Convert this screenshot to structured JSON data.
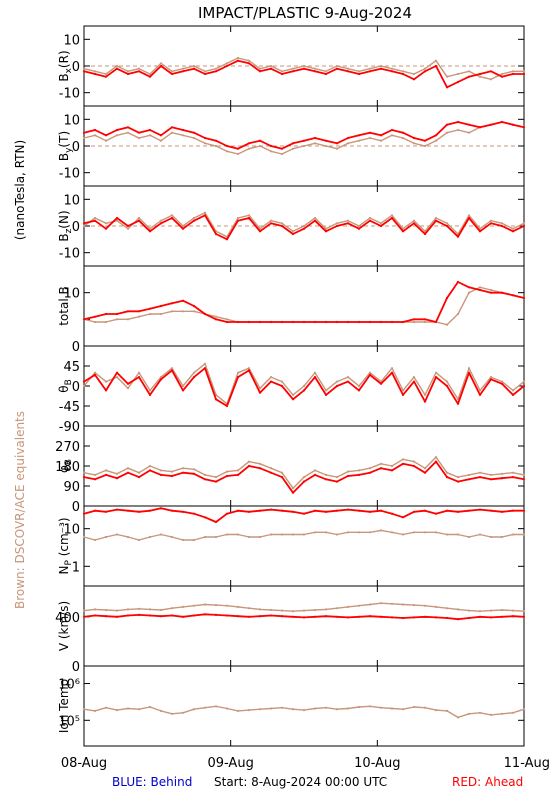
{
  "title": "IMPACT/PLASTIC    9-Aug-2024",
  "side_label": "(nanoTesla, RTN)",
  "brown_label": "Brown: DSCOVR/ACE equivalents",
  "footer": {
    "blue": "BLUE: Behind",
    "start": "Start:  8-Aug-2024 00:00 UTC",
    "red": "RED: Ahead"
  },
  "colors": {
    "ahead": "#ff0000",
    "dscovr": "#c8967a",
    "behind": "#0000cc",
    "brown_label": "#c8967a"
  },
  "chart_data": {
    "type": "line",
    "x_tick_labels": [
      "08-Aug",
      "09-Aug",
      "10-Aug",
      "11-Aug"
    ],
    "x_range_days": [
      0,
      3
    ],
    "panels": [
      {
        "id": "bx",
        "ylabel": "B",
        "ylabel_sub": "x",
        "ylabel_suffix": "(R)",
        "ylim": [
          -15,
          15
        ],
        "scale": "linear",
        "ticks": [
          {
            "v": 10,
            "label": "10"
          },
          {
            "v": 0,
            "label": "0"
          },
          {
            "v": -10,
            "label": "-10"
          }
        ],
        "dashed_zero": true,
        "series": [
          {
            "name": "Ahead",
            "color": "ahead",
            "values": [
              -2,
              -3,
              -4,
              -1,
              -3,
              -2,
              -4,
              0,
              -3,
              -2,
              -1,
              -3,
              -2,
              0,
              2,
              1,
              -2,
              -1,
              -3,
              -2,
              -1,
              -2,
              -3,
              -1,
              -2,
              -3,
              -2,
              -1,
              -2,
              -3,
              -5,
              -2,
              0,
              -8,
              -6,
              -4,
              -3,
              -2,
              -4,
              -3,
              -3
            ]
          },
          {
            "name": "DSCOVR",
            "color": "dscovr",
            "values": [
              -1,
              -2,
              -3,
              0,
              -2,
              -1,
              -3,
              1,
              -2,
              -1,
              0,
              -2,
              -1,
              1,
              3,
              2,
              -1,
              0,
              -2,
              -1,
              0,
              -1,
              -2,
              0,
              -1,
              -2,
              -1,
              0,
              -1,
              -2,
              -3,
              -1,
              2,
              -4,
              -3,
              -2,
              -4,
              -5,
              -3,
              -2,
              -2
            ]
          }
        ]
      },
      {
        "id": "by",
        "ylabel": "B",
        "ylabel_sub": "y",
        "ylabel_suffix": "(T)",
        "ylim": [
          -15,
          15
        ],
        "scale": "linear",
        "ticks": [
          {
            "v": 10,
            "label": "10"
          },
          {
            "v": 0,
            "label": "0"
          },
          {
            "v": -10,
            "label": "-10"
          }
        ],
        "dashed_zero": true,
        "series": [
          {
            "name": "Ahead",
            "color": "ahead",
            "values": [
              5,
              6,
              4,
              6,
              7,
              5,
              6,
              4,
              7,
              6,
              5,
              3,
              2,
              0,
              -1,
              1,
              2,
              0,
              -1,
              1,
              2,
              3,
              2,
              1,
              3,
              4,
              5,
              4,
              6,
              5,
              3,
              2,
              4,
              8,
              9,
              8,
              7,
              8,
              9,
              8,
              7
            ]
          },
          {
            "name": "DSCOVR",
            "color": "dscovr",
            "values": [
              3,
              4,
              2,
              4,
              5,
              3,
              4,
              2,
              5,
              4,
              3,
              1,
              0,
              -2,
              -3,
              -1,
              0,
              -2,
              -3,
              -1,
              0,
              1,
              0,
              -1,
              1,
              2,
              3,
              2,
              4,
              3,
              1,
              0,
              2,
              5,
              6,
              5,
              7,
              8,
              9,
              8,
              7
            ]
          }
        ]
      },
      {
        "id": "bz",
        "ylabel": "B",
        "ylabel_sub": "z",
        "ylabel_suffix": "(N)",
        "ylim": [
          -15,
          15
        ],
        "scale": "linear",
        "ticks": [
          {
            "v": 10,
            "label": "10"
          },
          {
            "v": 0,
            "label": "0"
          },
          {
            "v": -10,
            "label": "-10"
          }
        ],
        "dashed_zero": true,
        "series": [
          {
            "name": "Ahead",
            "color": "ahead",
            "values": [
              1,
              2,
              -1,
              3,
              0,
              2,
              -2,
              1,
              3,
              -1,
              2,
              4,
              -3,
              -5,
              2,
              3,
              -2,
              1,
              0,
              -3,
              -1,
              2,
              -2,
              0,
              1,
              -1,
              2,
              0,
              3,
              -2,
              1,
              -3,
              2,
              0,
              -4,
              3,
              -2,
              1,
              0,
              -2,
              0
            ]
          },
          {
            "name": "DSCOVR",
            "color": "dscovr",
            "values": [
              0,
              3,
              1,
              2,
              -1,
              3,
              -1,
              2,
              4,
              0,
              3,
              5,
              -2,
              -4,
              3,
              4,
              -1,
              2,
              1,
              -2,
              0,
              3,
              -1,
              1,
              2,
              0,
              3,
              1,
              4,
              -1,
              2,
              -2,
              3,
              1,
              -3,
              4,
              -1,
              2,
              1,
              -1,
              1
            ]
          }
        ]
      },
      {
        "id": "btot",
        "ylabel": "total B",
        "ylabel_sub": "",
        "ylabel_suffix": "",
        "ylim": [
          0,
          15
        ],
        "scale": "linear",
        "ticks": [
          {
            "v": 10,
            "label": "10"
          },
          {
            "v": 5,
            "label": ""
          },
          {
            "v": 0,
            "label": "0"
          }
        ],
        "dashed_zero": false,
        "series": [
          {
            "name": "Ahead",
            "color": "ahead",
            "values": [
              5,
              5.5,
              6,
              6,
              6.5,
              6.5,
              7,
              7.5,
              8,
              8.5,
              7.5,
              6,
              5,
              4.5,
              4.5,
              4.5,
              4.5,
              4.5,
              4.5,
              4.5,
              4.5,
              4.5,
              4.5,
              4.5,
              4.5,
              4.5,
              4.5,
              4.5,
              4.5,
              4.5,
              5,
              5,
              4.5,
              9,
              12,
              11,
              10.5,
              10,
              10,
              9.5,
              9
            ]
          },
          {
            "name": "DSCOVR",
            "color": "dscovr",
            "values": [
              5,
              4.5,
              4.5,
              5,
              5,
              5.5,
              6,
              6,
              6.5,
              6.5,
              6.5,
              6,
              5.5,
              5,
              4.5,
              4.5,
              4.5,
              4.5,
              4.5,
              4.5,
              4.5,
              4.5,
              4.5,
              4.5,
              4.5,
              4.5,
              4.5,
              4.5,
              4.5,
              4.5,
              4.5,
              4.5,
              4.5,
              4,
              6,
              10,
              11,
              10.5,
              10,
              9.5,
              9
            ]
          }
        ]
      },
      {
        "id": "theta",
        "ylabel": "θ",
        "ylabel_sub": "B",
        "ylabel_suffix": "",
        "ylim": [
          -90,
          90
        ],
        "scale": "linear",
        "ticks": [
          {
            "v": 45,
            "label": "45"
          },
          {
            "v": 0,
            "label": "0"
          },
          {
            "v": -45,
            "label": "-45"
          },
          {
            "v": -90,
            "label": "-90"
          }
        ],
        "dashed_zero": false,
        "series": [
          {
            "name": "Ahead",
            "color": "ahead",
            "values": [
              10,
              25,
              -10,
              30,
              5,
              20,
              -20,
              15,
              35,
              -10,
              20,
              40,
              -30,
              -45,
              20,
              35,
              -15,
              10,
              0,
              -30,
              -10,
              20,
              -20,
              0,
              10,
              -10,
              25,
              5,
              30,
              -20,
              10,
              -35,
              20,
              0,
              -40,
              30,
              -20,
              15,
              5,
              -20,
              0
            ]
          },
          {
            "name": "DSCOVR",
            "color": "dscovr",
            "values": [
              0,
              30,
              10,
              20,
              -5,
              30,
              -10,
              20,
              40,
              0,
              30,
              50,
              -20,
              -40,
              30,
              40,
              -5,
              20,
              10,
              -20,
              0,
              30,
              -10,
              10,
              20,
              0,
              30,
              10,
              40,
              -10,
              20,
              -20,
              30,
              10,
              -30,
              40,
              -10,
              20,
              10,
              -10,
              10
            ]
          }
        ]
      },
      {
        "id": "phi",
        "ylabel": "φ",
        "ylabel_sub": "B",
        "ylabel_suffix": "",
        "ylim": [
          0,
          360
        ],
        "scale": "linear",
        "ticks": [
          {
            "v": 270,
            "label": "270"
          },
          {
            "v": 180,
            "label": "180"
          },
          {
            "v": 90,
            "label": "90"
          },
          {
            "v": 0,
            "label": "0"
          }
        ],
        "dashed_zero": false,
        "series": [
          {
            "name": "Ahead",
            "color": "ahead",
            "values": [
              130,
              120,
              140,
              125,
              150,
              130,
              160,
              140,
              135,
              150,
              145,
              120,
              110,
              135,
              140,
              180,
              170,
              150,
              130,
              60,
              110,
              140,
              120,
              110,
              135,
              140,
              150,
              170,
              160,
              190,
              180,
              150,
              200,
              130,
              110,
              120,
              130,
              120,
              125,
              130,
              120
            ]
          },
          {
            "name": "DSCOVR",
            "color": "dscovr",
            "values": [
              150,
              140,
              160,
              145,
              170,
              150,
              180,
              160,
              155,
              170,
              165,
              140,
              130,
              155,
              160,
              200,
              190,
              170,
              150,
              80,
              130,
              160,
              140,
              130,
              155,
              160,
              170,
              190,
              180,
              210,
              200,
              170,
              220,
              150,
              130,
              140,
              150,
              140,
              145,
              150,
              140
            ]
          }
        ]
      },
      {
        "id": "np",
        "ylabel": "N",
        "ylabel_sub": "P",
        "ylabel_suffix": " (cm⁻³)",
        "ylim": [
          0.3,
          40
        ],
        "scale": "log",
        "ticks": [
          {
            "v": 10,
            "label": "10"
          },
          {
            "v": 1,
            "label": "1"
          }
        ],
        "dashed_zero": false,
        "series": [
          {
            "name": "Ahead",
            "color": "ahead",
            "values": [
              25,
              30,
              28,
              32,
              30,
              28,
              30,
              35,
              30,
              28,
              25,
              20,
              15,
              25,
              30,
              28,
              30,
              32,
              30,
              28,
              25,
              30,
              28,
              30,
              32,
              30,
              28,
              30,
              25,
              20,
              28,
              30,
              25,
              30,
              28,
              30,
              32,
              30,
              28,
              30,
              30
            ]
          },
          {
            "name": "DSCOVR",
            "color": "dscovr",
            "values": [
              6,
              5,
              6,
              7,
              6,
              5,
              6,
              7,
              6,
              5,
              5,
              6,
              6,
              7,
              7,
              6,
              6,
              7,
              7,
              7,
              7,
              8,
              8,
              7,
              8,
              8,
              8,
              9,
              8,
              7,
              8,
              8,
              8,
              7,
              7,
              6,
              7,
              6,
              6,
              7,
              7
            ]
          }
        ]
      },
      {
        "id": "v",
        "ylabel": "V (km/s)",
        "ylabel_sub": "",
        "ylabel_suffix": "",
        "ylim": [
          0,
          650
        ],
        "scale": "linear",
        "ticks": [
          {
            "v": 400,
            "label": "400"
          },
          {
            "v": 0,
            "label": "0"
          }
        ],
        "dashed_zero": false,
        "series": [
          {
            "name": "Ahead",
            "color": "ahead",
            "values": [
              400,
              410,
              405,
              400,
              410,
              415,
              410,
              405,
              410,
              400,
              410,
              420,
              415,
              410,
              405,
              400,
              405,
              410,
              405,
              400,
              395,
              400,
              405,
              400,
              395,
              400,
              405,
              400,
              395,
              390,
              395,
              400,
              395,
              390,
              380,
              390,
              400,
              395,
              400,
              405,
              400
            ]
          },
          {
            "name": "DSCOVR",
            "color": "dscovr",
            "values": [
              450,
              460,
              455,
              450,
              460,
              465,
              460,
              455,
              470,
              480,
              490,
              500,
              495,
              490,
              480,
              470,
              460,
              455,
              450,
              445,
              450,
              455,
              460,
              470,
              480,
              490,
              500,
              510,
              505,
              500,
              495,
              490,
              480,
              470,
              460,
              450,
              445,
              450,
              455,
              450,
              445
            ]
          }
        ]
      },
      {
        "id": "temp",
        "ylabel": "Ion Temp",
        "ylabel_sub": "",
        "ylabel_suffix": "",
        "ylim": [
          20000,
          3000000
        ],
        "scale": "log",
        "ticks": [
          {
            "v": 1000000,
            "label": "10⁶"
          },
          {
            "v": 100000,
            "label": "10⁵"
          }
        ],
        "dashed_zero": false,
        "series": [
          {
            "name": "DSCOVR",
            "color": "dscovr",
            "values": [
              200000,
              180000,
              220000,
              190000,
              210000,
              200000,
              230000,
              180000,
              150000,
              160000,
              200000,
              220000,
              240000,
              210000,
              180000,
              190000,
              200000,
              210000,
              220000,
              200000,
              190000,
              210000,
              220000,
              200000,
              210000,
              230000,
              240000,
              220000,
              210000,
              200000,
              230000,
              220000,
              190000,
              180000,
              120000,
              150000,
              160000,
              140000,
              150000,
              160000,
              200000
            ]
          }
        ]
      }
    ]
  }
}
